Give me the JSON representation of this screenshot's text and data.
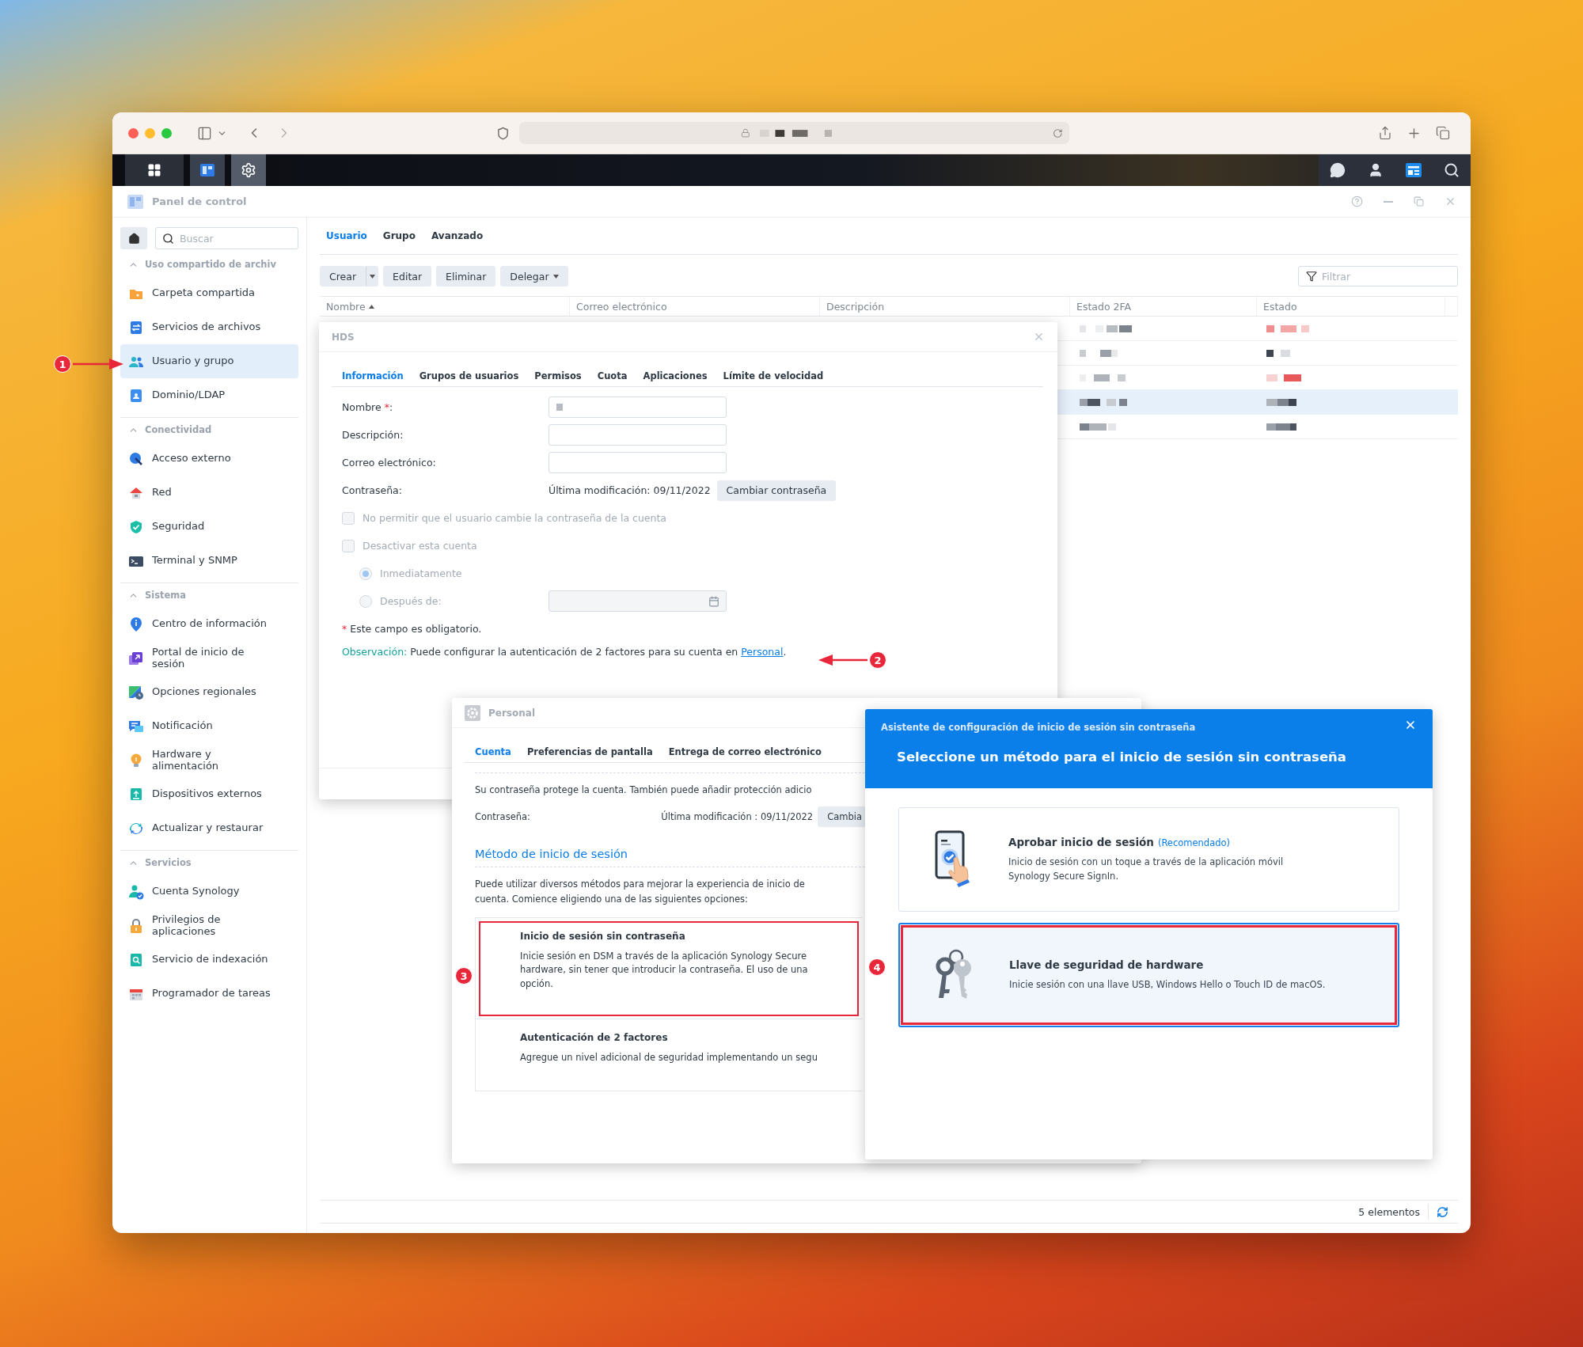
{
  "window": {
    "title": "Panel de control"
  },
  "sidebar": {
    "search": {
      "placeholder": "Buscar"
    },
    "sections": [
      {
        "title": "Uso compartido de archiv",
        "expanded": true,
        "items": [
          {
            "label": "Carpeta compartida",
            "selected": false
          },
          {
            "label": "Servicios de archivos",
            "selected": false
          },
          {
            "label": "Usuario y grupo",
            "selected": true
          },
          {
            "label": "Dominio/LDAP",
            "selected": false
          }
        ]
      },
      {
        "title": "Conectividad",
        "expanded": true,
        "items": [
          {
            "label": "Acceso externo",
            "selected": false
          },
          {
            "label": "Red",
            "selected": false
          },
          {
            "label": "Seguridad",
            "selected": false
          },
          {
            "label": "Terminal y SNMP",
            "selected": false
          }
        ]
      },
      {
        "title": "Sistema",
        "expanded": true,
        "items": [
          {
            "label": "Centro de información",
            "selected": false
          },
          {
            "label": "Portal de inicio de sesión",
            "selected": false
          },
          {
            "label": "Opciones regionales",
            "selected": false
          },
          {
            "label": "Notificación",
            "selected": false
          },
          {
            "label": "Hardware y alimentación",
            "selected": false
          },
          {
            "label": "Dispositivos externos",
            "selected": false
          },
          {
            "label": "Actualizar y restaurar",
            "selected": false
          }
        ]
      },
      {
        "title": "Servicios",
        "expanded": true,
        "items": [
          {
            "label": "Cuenta Synology",
            "selected": false
          },
          {
            "label": "Privilegios de aplicaciones",
            "selected": false
          },
          {
            "label": "Servicio de indexación",
            "selected": false
          },
          {
            "label": "Programador de tareas",
            "selected": false
          }
        ]
      }
    ]
  },
  "tabs": [
    {
      "label": "Usuario",
      "selected": true
    },
    {
      "label": "Grupo",
      "selected": false
    },
    {
      "label": "Avanzado",
      "selected": false
    }
  ],
  "toolbar": {
    "buttons": [
      {
        "label": "Crear",
        "kind": "split"
      },
      {
        "label": "Editar",
        "kind": "plain"
      },
      {
        "label": "Eliminar",
        "kind": "plain"
      },
      {
        "label": "Delegar",
        "kind": "menu"
      }
    ],
    "filter": {
      "placeholder": "Filtrar"
    }
  },
  "table": {
    "columns": [
      {
        "label": "Nombre",
        "sorted": true
      },
      {
        "label": "Correo electrónico",
        "sorted": false
      },
      {
        "label": "Descripción",
        "sorted": false
      },
      {
        "label": "Estado 2FA",
        "sorted": false
      },
      {
        "label": "Estado",
        "sorted": false
      }
    ],
    "rows": [
      {
        "selected": false
      },
      {
        "selected": false
      },
      {
        "selected": false
      },
      {
        "selected": true
      },
      {
        "selected": false
      }
    ]
  },
  "footer": {
    "count": "5 elementos"
  },
  "user_dialog": {
    "title": "HDS",
    "tabs": [
      {
        "label": "Información",
        "selected": true
      },
      {
        "label": "Grupos de usuarios",
        "selected": false
      },
      {
        "label": "Permisos",
        "selected": false
      },
      {
        "label": "Cuota",
        "selected": false
      },
      {
        "label": "Aplicaciones",
        "selected": false
      },
      {
        "label": "Límite de velocidad",
        "selected": false
      }
    ],
    "fields": [
      {
        "kind": "text",
        "label": "Nombre",
        "required_mark": "*",
        "label_end": ":",
        "redacted": true
      },
      {
        "kind": "text",
        "label": "Descripción:",
        "redacted": false
      },
      {
        "kind": "text",
        "label": "Correo electrónico:",
        "redacted": false
      },
      {
        "kind": "password",
        "label": "Contraseña:",
        "info": "Última modificación: 09/11/2022",
        "button": "Cambiar contraseña"
      }
    ],
    "checkboxes": [
      {
        "label": "No permitir que el usuario cambie la contraseña de la cuenta",
        "checked": false,
        "disabled": true
      },
      {
        "label": "Desactivar esta cuenta",
        "checked": false,
        "disabled": true
      }
    ],
    "radios": [
      {
        "kind": "plain",
        "label": "Inmediatamente",
        "selected": true,
        "disabled": true
      },
      {
        "kind": "date",
        "label": "Después de:",
        "selected": false,
        "disabled": true
      }
    ],
    "note": {
      "mark": "*",
      "text": "Este campo es obligatorio."
    },
    "observation": {
      "label": "Observación:",
      "text": "Puede configurar la autenticación de 2 factores para su cuenta en",
      "link": "Personal",
      "end": "."
    }
  },
  "personal_dialog": {
    "title": "Personal",
    "tabs": [
      {
        "label": "Cuenta",
        "selected": true
      },
      {
        "label": "Preferencias de pantalla",
        "selected": false
      },
      {
        "label": "Entrega de correo electrónico",
        "selected": false
      }
    ],
    "intro": "Su contraseña protege la cuenta. También puede añadir protección adicio",
    "password": {
      "label": "Contraseña:",
      "info": "Última modificación : 09/11/2022",
      "button": "Cambia"
    },
    "section_title": "Método de inicio de sesión",
    "section_intro": [
      "Puede utilizar diversos métodos para mejorar la experiencia de inicio de",
      "cuenta. Comience eligiendo una de las siguientes opciones:"
    ],
    "options": [
      {
        "title": "Inicio de sesión sin contraseña",
        "lines": [
          "Inicie sesión en DSM a través de la aplicación Synology Secure",
          "hardware, sin tener que introducir la contraseña. El uso de una",
          "opción."
        ],
        "highlighted": true
      },
      {
        "title": "Autenticación de 2 factores",
        "lines": [
          "Agregue un nivel adicional de seguridad implementando un segu"
        ],
        "highlighted": false
      }
    ]
  },
  "wizard": {
    "title": "Asistente de configuración de inicio de sesión sin contraseña",
    "heading": "Seleccione un método para el inicio de sesión sin contraseña",
    "methods": [
      {
        "kind": "phone",
        "title": "Aprobar inicio de sesión",
        "tag": "(Recomendado)",
        "description": "Inicio de sesión con un toque a través de la aplicación móvil Synology Secure SignIn.",
        "selected": false,
        "highlighted": false
      },
      {
        "kind": "keys",
        "title": "Llave de seguridad de hardware",
        "description": "Inicie sesión con una llave USB, Windows Hello o Touch ID de macOS.",
        "selected": true,
        "highlighted": true
      }
    ]
  },
  "annotations": [
    {
      "number": "1"
    },
    {
      "number": "2"
    },
    {
      "number": "3"
    },
    {
      "number": "4"
    }
  ]
}
